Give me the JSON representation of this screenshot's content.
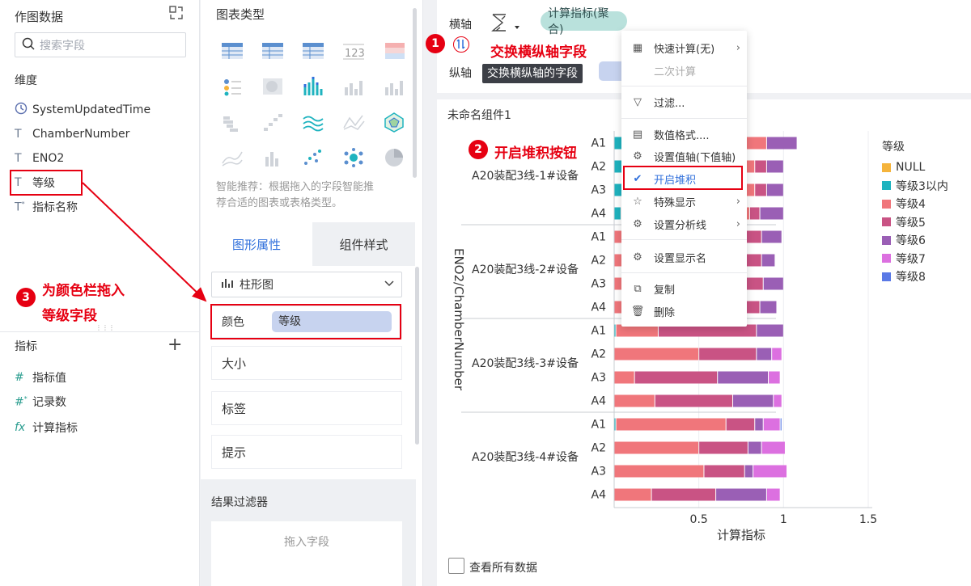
{
  "left": {
    "title": "作图数据",
    "search_placeholder": "搜索字段",
    "dimensions_label": "维度",
    "dimensions": [
      {
        "name": "SystemUpdatedTime",
        "icon": "clock-icon"
      },
      {
        "name": "ChamberNumber",
        "icon": "text-type-icon"
      },
      {
        "name": "ENO2",
        "icon": "text-type-icon"
      },
      {
        "name": "等级",
        "icon": "text-type-icon"
      },
      {
        "name": "指标名称",
        "icon": "text-type-icon"
      }
    ],
    "measures_label": "指标",
    "measures": [
      {
        "name": "指标值",
        "icon": "hash-icon"
      },
      {
        "name": "记录数",
        "icon": "hash-icon"
      },
      {
        "name": "计算指标",
        "icon": "fx-icon"
      }
    ]
  },
  "mid": {
    "chart_type_title": "图表类型",
    "recommend_text_1": "智能推荐：根据拖入的字段智能推",
    "recommend_text_2": "荐合适的图表或表格类型。",
    "table_number_label": "123",
    "tabs": [
      "图形属性",
      "组件样式"
    ],
    "chart_select": "柱形图",
    "props": {
      "color": "颜色",
      "color_field": "等级",
      "size": "大小",
      "label": "标签",
      "tooltip": "提示"
    },
    "result_filter": "结果过滤器",
    "drop_field": "拖入字段"
  },
  "axis": {
    "x_label": "横轴",
    "x_field": "计算指标(聚合)",
    "y_label": "纵轴",
    "y_field_partial": "Ch",
    "swap_tooltip": "交换横纵轴的字段"
  },
  "chart": {
    "widget_name": "未命名组件1",
    "view_all": "查看所有数据"
  },
  "menu": {
    "items": [
      "快速计算(无)",
      "二次计算",
      "过滤...",
      "数值格式....",
      "设置值轴(下值轴)",
      "开启堆积",
      "特殊显示",
      "设置分析线",
      "设置显示名",
      "复制",
      "删除"
    ]
  },
  "annotations": {
    "a1_num": "1",
    "a1_text": "交换横纵轴字段",
    "a2_num": "2",
    "a2_text": "开启堆积按钮",
    "a3_num": "3",
    "a3_text_1": "为颜色栏拖入",
    "a3_text_2": "等级字段"
  },
  "colors": {
    "NULL": "#f5b43c",
    "等级3以内": "#1fb3bf",
    "等级4": "#f0767b",
    "等级5": "#c95384",
    "等级6": "#9a5fb5",
    "等级7": "#dc70e0",
    "等级8": "#5a79e6",
    "accent": "#2f6fdb",
    "annotation": "#e60012"
  },
  "chart_data": {
    "type": "bar",
    "orientation": "horizontal",
    "stacked": true,
    "xlabel": "计算指标",
    "ylabel": "ENO2/ChamberNumber",
    "xlim": [
      0,
      1.5
    ],
    "xticks": [
      "0.5",
      "1",
      "1.5"
    ],
    "legend": {
      "title": "等级",
      "position": "right",
      "entries": [
        "NULL",
        "等级3以内",
        "等级4",
        "等级5",
        "等级6",
        "等级7",
        "等级8"
      ]
    },
    "groups": [
      {
        "name": "A20装配3线-1#设备",
        "rows": [
          {
            "cat": "A1",
            "segments": [
              [
                "等级3以内",
                0.05
              ],
              [
                "等级5",
                0.07
              ],
              [
                "NULL",
                0.0
              ],
              [
                "等级4",
                0.78
              ],
              [
                "等级6",
                0.18
              ]
            ]
          },
          {
            "cat": "A2",
            "segments": [
              [
                "等级3以内",
                0.05
              ],
              [
                "等级4",
                0.78
              ],
              [
                "等级5",
                0.07
              ],
              [
                "等级6",
                0.1
              ]
            ]
          },
          {
            "cat": "A3",
            "segments": [
              [
                "等级3以内",
                0.05
              ],
              [
                "等级4",
                0.78
              ],
              [
                "等级5",
                0.07
              ],
              [
                "等级6",
                0.1
              ]
            ]
          },
          {
            "cat": "A4",
            "segments": [
              [
                "等级3以内",
                0.04
              ],
              [
                "等级4",
                0.76
              ],
              [
                "等级5",
                0.06
              ],
              [
                "等级6",
                0.14
              ]
            ]
          }
        ]
      },
      {
        "name": "A20装配3线-2#设备",
        "rows": [
          {
            "cat": "A1",
            "segments": [
              [
                "等级4",
                0.05
              ],
              [
                "等级5",
                0.82
              ],
              [
                "等级6",
                0.12
              ]
            ]
          },
          {
            "cat": "A2",
            "segments": [
              [
                "等级4",
                0.08
              ],
              [
                "等级5",
                0.79
              ],
              [
                "等级6",
                0.08
              ]
            ]
          },
          {
            "cat": "A3",
            "segments": [
              [
                "等级4",
                0.08
              ],
              [
                "等级5",
                0.8
              ],
              [
                "等级6",
                0.12
              ]
            ]
          },
          {
            "cat": "A4",
            "segments": [
              [
                "等级4",
                0.06
              ],
              [
                "等级5",
                0.8
              ],
              [
                "等级6",
                0.1
              ]
            ]
          }
        ]
      },
      {
        "name": "A20装配3线-3#设备",
        "rows": [
          {
            "cat": "A1",
            "segments": [
              [
                "等级3以内",
                0.01
              ],
              [
                "等级4",
                0.25
              ],
              [
                "等级5",
                0.58
              ],
              [
                "等级6",
                0.16
              ]
            ]
          },
          {
            "cat": "A2",
            "segments": [
              [
                "等级4",
                0.5
              ],
              [
                "等级5",
                0.34
              ],
              [
                "等级6",
                0.09
              ],
              [
                "等级7",
                0.06
              ]
            ]
          },
          {
            "cat": "A3",
            "segments": [
              [
                "等级4",
                0.12
              ],
              [
                "等级5",
                0.49
              ],
              [
                "等级6",
                0.3
              ],
              [
                "等级7",
                0.07
              ]
            ]
          },
          {
            "cat": "A4",
            "segments": [
              [
                "等级4",
                0.24
              ],
              [
                "等级5",
                0.46
              ],
              [
                "等级6",
                0.24
              ],
              [
                "等级7",
                0.05
              ]
            ]
          }
        ]
      },
      {
        "name": "A20装配3线-4#设备",
        "rows": [
          {
            "cat": "A1",
            "segments": [
              [
                "等级3以内",
                0.01
              ],
              [
                "等级4",
                0.65
              ],
              [
                "等级5",
                0.17
              ],
              [
                "等级6",
                0.05
              ],
              [
                "等级7",
                0.1
              ],
              [
                "等级8",
                0.01
              ]
            ]
          },
          {
            "cat": "A2",
            "segments": [
              [
                "等级4",
                0.5
              ],
              [
                "等级5",
                0.29
              ],
              [
                "等级6",
                0.08
              ],
              [
                "等级7",
                0.14
              ]
            ]
          },
          {
            "cat": "A3",
            "segments": [
              [
                "等级4",
                0.53
              ],
              [
                "等级5",
                0.24
              ],
              [
                "等级6",
                0.05
              ],
              [
                "等级7",
                0.2
              ]
            ]
          },
          {
            "cat": "A4",
            "segments": [
              [
                "等级4",
                0.22
              ],
              [
                "等级5",
                0.38
              ],
              [
                "等级6",
                0.3
              ],
              [
                "等级7",
                0.08
              ]
            ]
          }
        ]
      }
    ]
  }
}
